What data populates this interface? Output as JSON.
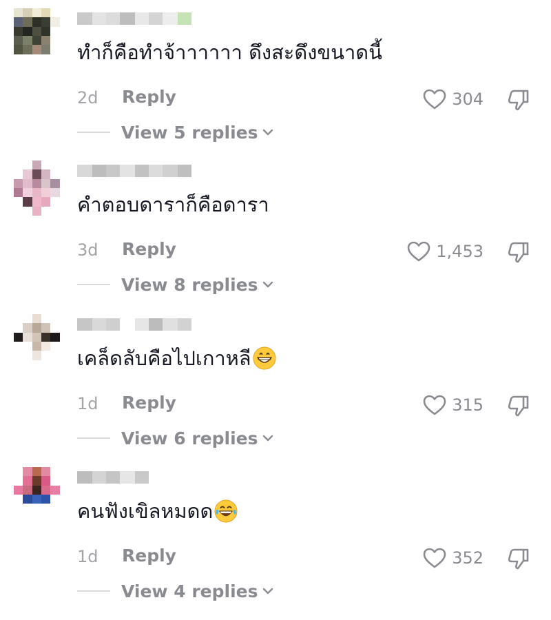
{
  "comments": [
    {
      "text": "ทำก็คือทำจ้าาาาาา ดึงสะดึงขนาดนี้",
      "emoji": "",
      "time": "2d",
      "reply_label": "Reply",
      "likes": "304",
      "view_replies": "View 5 replies",
      "avatar_colors": [
        "#e8e4d2",
        "#d6cfb6",
        "#f1ecd8",
        "#e3d9b5",
        "#ffffff",
        "#ffffff",
        "#5a6376",
        "#6f6d58",
        "#2e2f26",
        "#3a3d33",
        "#f1eee4",
        "#ffffff",
        "#3b3a2f",
        "#222520",
        "#4d4f40",
        "#2f332a",
        "#ffffff",
        "#ffffff",
        "#5b5e4f",
        "#7b8068",
        "#3f4237",
        "#8a826e",
        "#ffffff",
        "#ffffff",
        "#51553f",
        "#6d6f5b",
        "#a58a7a",
        "#7c7d6e",
        "#ffffff",
        "#ffffff",
        "#ffffff",
        "#ffffff",
        "#ffffff",
        "#ffffff",
        "#ffffff",
        "#ffffff"
      ],
      "username_colors": [
        "#c9c9c9",
        "#e3e3e3",
        "#dcdcdc",
        "#bdbdbd",
        "#e8e8e8",
        "#d4d4d4",
        "#ededed",
        "#c6e3b5"
      ]
    },
    {
      "text": "คำตอบดาราก็คือดารา",
      "emoji": "",
      "time": "3d",
      "reply_label": "Reply",
      "likes": "1,453",
      "view_replies": "View 8 replies",
      "avatar_colors": [
        "#ffffff",
        "#ffffff",
        "#c9a7b6",
        "#ffffff",
        "#ffffff",
        "#ffffff",
        "#ffffff",
        "#e6c9d4",
        "#6b4b57",
        "#d4b6c3",
        "#ffffff",
        "#ffffff",
        "#c79aae",
        "#e2bccb",
        "#b78aa0",
        "#d9c4cc",
        "#a88fa0",
        "#ffffff",
        "#b07b92",
        "#f0d0dc",
        "#e7b7c8",
        "#f2cfd8",
        "#e8d9e0",
        "#ffffff",
        "#ffffff",
        "#5a3d46",
        "#f0b9cb",
        "#e6a8bd",
        "#ffffff",
        "#ffffff",
        "#ffffff",
        "#ffffff",
        "#eab1c5",
        "#ffffff",
        "#ffffff",
        "#ffffff"
      ],
      "username_colors": [
        "#d8d8d8",
        "#bdbdbd",
        "#c8c8c8",
        "#e3e3e3",
        "#c2c2c2",
        "#dcdcdc",
        "#d0d0d0",
        "#bfbfbf"
      ]
    },
    {
      "text": "เคล็ดลับคือไปเกาหลี",
      "emoji": "grinning-face-emoji",
      "time": "1d",
      "reply_label": "Reply",
      "likes": "315",
      "view_replies": "View 6 replies",
      "avatar_colors": [
        "#ffffff",
        "#ffffff",
        "#e7ddd3",
        "#ffffff",
        "#ffffff",
        "#ffffff",
        "#ffffff",
        "#d9cfc6",
        "#b8a898",
        "#cfc3b8",
        "#ffffff",
        "#ffffff",
        "#1f1b1a",
        "#e8e0d8",
        "#d2c4b6",
        "#3a302a",
        "#1c1918",
        "#ffffff",
        "#ffffff",
        "#ffffff",
        "#c7b8aa",
        "#f1e9e2",
        "#ffffff",
        "#ffffff",
        "#ffffff",
        "#ffffff",
        "#eee6de",
        "#ffffff",
        "#ffffff",
        "#ffffff",
        "#ffffff",
        "#ffffff",
        "#ffffff",
        "#ffffff",
        "#ffffff",
        "#ffffff"
      ],
      "username_colors": [
        "#c6c6c6",
        "#d9d9d9",
        "#cfcfcf",
        "#ffffff",
        "#e6e6e6",
        "#bcbcbc",
        "#e0e0e0",
        "#d2d2d2"
      ]
    },
    {
      "text": "คนฟังเขิลหมดด",
      "emoji": "tears-of-joy-emoji",
      "time": "1d",
      "reply_label": "Reply",
      "likes": "352",
      "view_replies": "View 4 replies",
      "avatar_colors": [
        "#ffffff",
        "#e58aa5",
        "#b86a4e",
        "#e28aa2",
        "#ffffff",
        "#ffffff",
        "#ffffff",
        "#e46f95",
        "#6a3b2b",
        "#d85b85",
        "#ffffff",
        "#ffffff",
        "#e978a0",
        "#c96b7e",
        "#3a2420",
        "#d96a8c",
        "#e77fa2",
        "#ffffff",
        "#ffffff",
        "#2a4a9a",
        "#3a62b8",
        "#2b53a8",
        "#ffffff",
        "#ffffff",
        "#ffffff",
        "#ffffff",
        "#ffffff",
        "#ffffff",
        "#ffffff",
        "#ffffff",
        "#ffffff",
        "#ffffff",
        "#ffffff",
        "#ffffff",
        "#ffffff",
        "#ffffff"
      ],
      "username_colors": [
        "#bdbdbd",
        "#d4d4d4",
        "#c5c5c5",
        "#e6e6e6",
        "#c9c9c9",
        "#ffffff",
        "#ffffff",
        "#ffffff"
      ]
    }
  ],
  "colors": {
    "text": "#161823",
    "muted": "#8a8b91",
    "timestamp": "#a3a4a8",
    "divider": "#d8d9dc"
  }
}
